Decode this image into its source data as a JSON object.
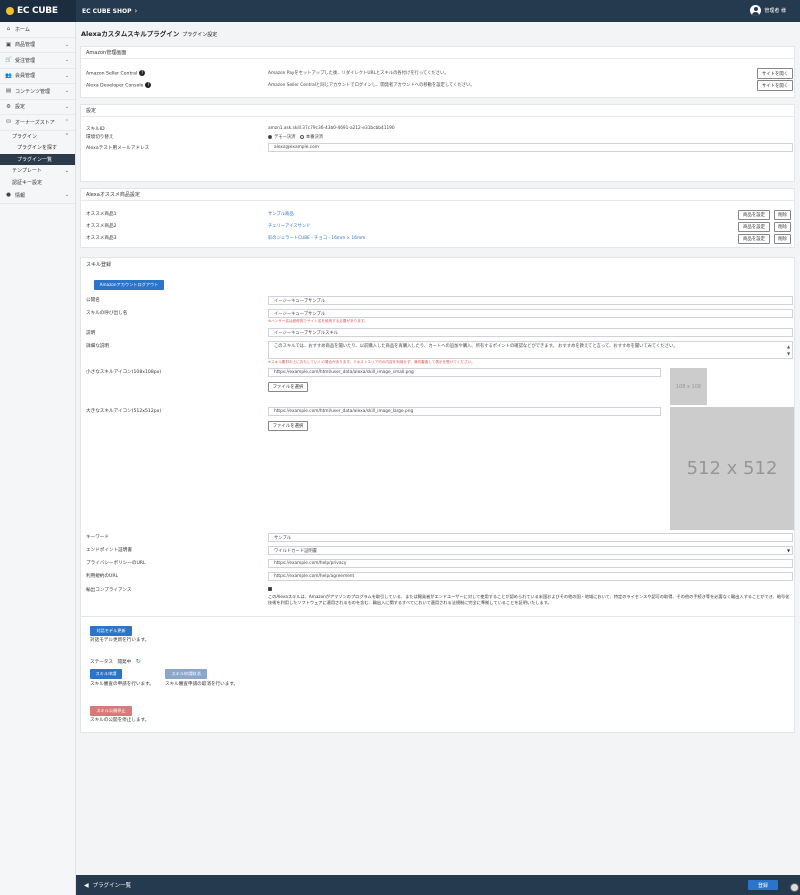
{
  "header": {
    "logo": "EC CUBE",
    "shop": "EC CUBE SHOP",
    "user": "管理者 様"
  },
  "sidebar": {
    "items": [
      {
        "icon": "⌂",
        "label": "ホーム"
      },
      {
        "icon": "▣",
        "label": "商品管理"
      },
      {
        "icon": "🛒",
        "label": "受注管理"
      },
      {
        "icon": "👥",
        "label": "会員管理"
      },
      {
        "icon": "▤",
        "label": "コンテンツ管理"
      },
      {
        "icon": "⚙",
        "label": "設定"
      },
      {
        "icon": "⛁",
        "label": "オーナーズストア"
      }
    ],
    "plugin": "プラグイン",
    "plugin_search": "プラグインを探す",
    "plugin_list": "プラグイン一覧",
    "template": "テンプレート",
    "auth_key": "認証キー設定",
    "info_icon": "●",
    "info": "情報"
  },
  "page": {
    "title": "Alexaカスタムスキルプラグイン",
    "subtitle": "プラグイン設定"
  },
  "amazon": {
    "header": "Amazon管理画面",
    "rows": [
      {
        "label": "Amazon Seller Central",
        "desc": "Amazon Payをセットアップした後、リダイレクトURLとスキルの各付けを行ってください。",
        "button": "サイトを開く"
      },
      {
        "label": "Alexa Developer Console",
        "desc": "Amazon Seller Centralと同じアカウントでログインし、開発者アカウントへの移動を設定してください。",
        "button": "サイトを開く"
      }
    ]
  },
  "settings": {
    "header": "設定",
    "skill_id_label": "スキルID",
    "skill_id_value": "amzn1.ask.skill.37c79c36-43b0-4691-a212-e31bcbb41190",
    "env_label": "環境切り替え",
    "env_demo": "デモ一決済",
    "env_prod": "本番決済",
    "email_label": "Alexaテスト用メールアドレス",
    "email_value": "alexa@example.com"
  },
  "recommend": {
    "header": "Alexaオススメ商品設定",
    "rows": [
      {
        "label": "オススメ商品1",
        "product": "サンプル商品",
        "set": "商品を設定",
        "del": "削除"
      },
      {
        "label": "オススメ商品2",
        "product": "チェリーアイスサンド",
        "set": "商品を設定",
        "del": "削除"
      },
      {
        "label": "オススメ商品3",
        "product": "彩のジェラートCUBE - チョコ - 16mm × 16mm",
        "set": "商品を設定",
        "del": "削除"
      }
    ]
  },
  "skill": {
    "header": "スキル登録",
    "logout": "Amazonアカウントログアウト",
    "name_label": "公開名",
    "name_value": "イージーキューブサンプル",
    "invoke_label": "スキルの呼び出し名",
    "invoke_value": "イージーキューブサンプル",
    "invoke_note": "※ハンザー名は総称的でサイト名を使用する必要があります。",
    "desc_label": "説明",
    "desc_value": "イージーキューブサンプルスキル",
    "detail_label": "詳細な説明",
    "detail_value": "このスキルでは、おすすめ商品を聞いたり、以前購入した商品を再購入したり、カートへの追加や購入、所有するポイントの確認などができます。 おすすめを教えてと言って、おすすめを聞いてみてください。",
    "detail_note": "※スキル素材の上におもしていくの場合があります。テキストエリア内の内容を利用せず、適切審査して表示を受けてください。",
    "small_icon_label": "小さなスキルアイコン(108x108px)",
    "small_icon_url": "https://example.com/html/user_data/alexa/skill_image_small.png",
    "small_file_btn": "ファイルを選択",
    "small_placeholder": "108 x 108",
    "large_icon_label": "大きなスキルアイコン(512x512px)",
    "large_icon_url": "https://example.com/html/user_data/alexa/skill_image_large.png",
    "large_file_btn": "ファイルを選択",
    "large_placeholder": "512 x 512",
    "keyword_label": "キーワード",
    "keyword_value": "サンプル",
    "endpoint_label": "エンドポイント証明書",
    "endpoint_value": "ワイルドカード証明書",
    "privacy_label": "プライバシーポリシーのURL",
    "privacy_value": "https://example.com/help/privacy",
    "terms_label": "利用規約のURL",
    "terms_value": "https://example.com/help/agreement",
    "export_label": "輸出コンプライアンス",
    "export_text": "このAlexaスキルは、Amazonがアマゾンのプログラムを取引している、または開発者がエンドユーザーに対して使用することが認められている米国およびその他の国・地域において、特定のライセンスや認可の取得、その他の手続き等を必要なく輸出入することができ、暗号化技術を利用したソフトウェアに適用されるものを含む、輸出入に関するすべてにおいて適用される法規制に完全に準拠していることを証明いたします。"
  },
  "actions": {
    "model_btn": "対話モデル更新",
    "model_desc": "対話モデル更新を行います。",
    "status_label": "ステータス",
    "status_value": "開発中",
    "review_btn": "スキル申請",
    "review_desc": "スキル審査の申請を行います。",
    "withdraw_btn": "スキル申請取消",
    "withdraw_desc": "スキル審査申請の取消を行います。",
    "stop_btn": "スキル公開停止",
    "stop_desc": "スキルの公開を停止します。"
  },
  "footer": {
    "back": "プラグイン一覧",
    "save": "登録"
  }
}
